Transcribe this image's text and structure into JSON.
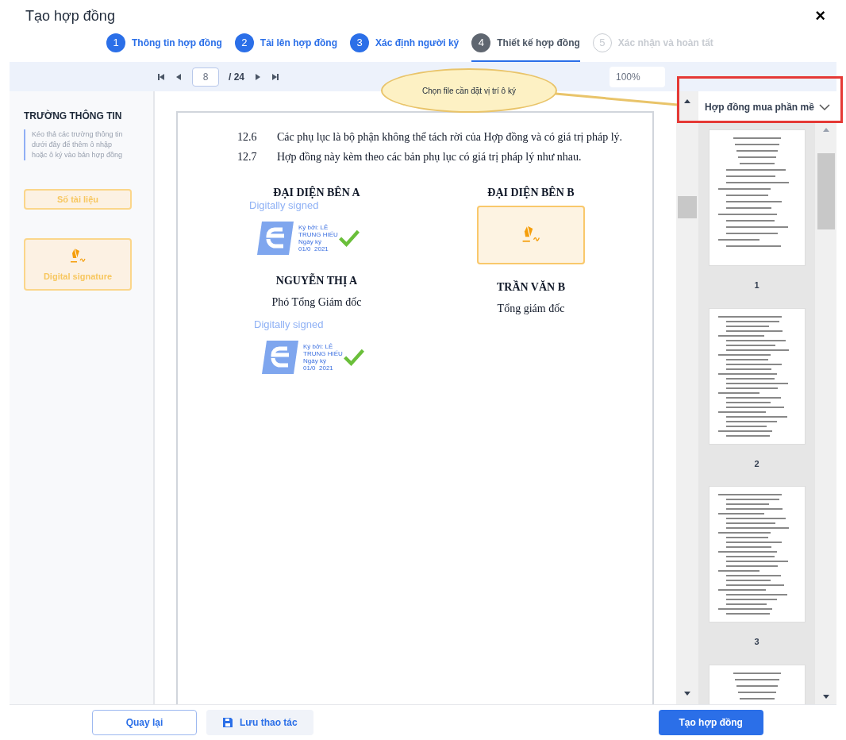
{
  "window": {
    "title": "Tạo hợp đồng",
    "close": "×"
  },
  "steps": [
    {
      "number": "1",
      "label": "Thông tin hợp đồng",
      "completed": true,
      "disabled": false,
      "selected": false
    },
    {
      "number": "2",
      "label": "Tải lên hợp đồng",
      "completed": true,
      "disabled": false,
      "selected": false
    },
    {
      "number": "3",
      "label": "Xác định người ký",
      "completed": true,
      "disabled": false,
      "selected": false
    },
    {
      "number": "4",
      "label": "Thiết kế hợp đồng",
      "completed": false,
      "disabled": false,
      "selected": true
    },
    {
      "number": "5",
      "label": "Xác nhận và hoàn tất",
      "completed": false,
      "disabled": true,
      "selected": false
    }
  ],
  "toolbar": {
    "page": "8",
    "total": "/ 24",
    "zoom": "100%"
  },
  "tooltip": "Chọn file cần đặt vị trí ô ký",
  "file_select": {
    "value": "Hợp đồng mua phần mề"
  },
  "fields_panel": {
    "title": "TRƯỜNG THÔNG TIN",
    "hint": "Kéo thả các trường thông tin dưới đây để thêm ô nhập hoặc ô ký vào bản hợp đồng",
    "items": [
      {
        "kind": "text",
        "label": "Số tài liệu"
      },
      {
        "kind": "signature",
        "label": "Digital signature"
      }
    ]
  },
  "document": {
    "clauses": [
      {
        "number": "12.6",
        "text": "Các phụ lục là bộ phận không thể tách rời của Hợp đồng và có giá trị pháp lý."
      },
      {
        "number": "12.7",
        "text": "Hợp đồng này kèm theo các bản phụ lục có giá trị pháp lý như nhau."
      }
    ],
    "parties": [
      {
        "heading": "ĐẠI DIỆN BÊN A",
        "signature": {
          "kind": "signed",
          "label": "Digitally signed",
          "lines": [
            "Ký bởi: LÊ",
            "TRUNG HIẾU",
            "Ngày ký",
            "01/0  2021"
          ]
        },
        "name": "NGUYỄN THỊ A",
        "role": "Phó Tổng Giám đốc"
      },
      {
        "heading": "ĐẠI DIỆN BÊN B",
        "signature": {
          "kind": "placeholder"
        },
        "name": "TRẦN VĂN B",
        "role": "Tổng giám đốc"
      }
    ],
    "extra_signature": {
      "kind": "signed",
      "label": "Digitally signed",
      "lines": [
        "Ký bởi: LÊ",
        "TRUNG HIẾU",
        "Ngày ký",
        "01/0  2021"
      ]
    }
  },
  "thumbnails": [
    {
      "kind": "page",
      "label": "1"
    },
    {
      "kind": "page",
      "label": "2"
    },
    {
      "kind": "page",
      "label": "3"
    },
    {
      "kind": "page"
    }
  ],
  "footer": {
    "back": "Quay lại",
    "save": "Lưu thao tác",
    "create": "Tạo hợp đồng"
  }
}
